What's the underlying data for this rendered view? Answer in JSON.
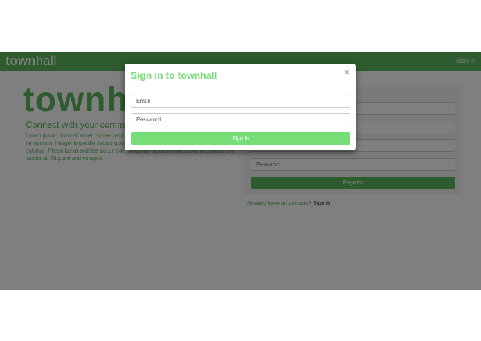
{
  "navbar": {
    "brand_bold": "town",
    "brand_light": "hall",
    "signin_label": "Sign In"
  },
  "hero": {
    "logo": "townhall",
    "tagline": "Connect with your community",
    "body": "Lorem ipsum dolor sit amet, consectetur adipiscing elit. Phasellus ac elementum fermentum. Integer imperdiet lectus quis justo. Vestibulum imperdiet sodales justo ut pulvinar. Phasellus at sodales accumsan. Vivamus faucibus metus elit, in tempus est lacinia ut. Aliquam and volutpat."
  },
  "register": {
    "inputs": [
      "",
      "",
      "",
      "Password"
    ],
    "button_label": "Register",
    "footer_text": "Already have an account?",
    "footer_link": "Sign In"
  },
  "modal": {
    "title": "Sign in to townhall",
    "close_glyph": "×",
    "email_placeholder": "Email",
    "password_placeholder": "Password",
    "button_label": "Sign In"
  },
  "colors": {
    "navbar": "#5cb85c",
    "accent": "#77dd77",
    "backdrop": "rgba(0,0,0,0.5)"
  }
}
